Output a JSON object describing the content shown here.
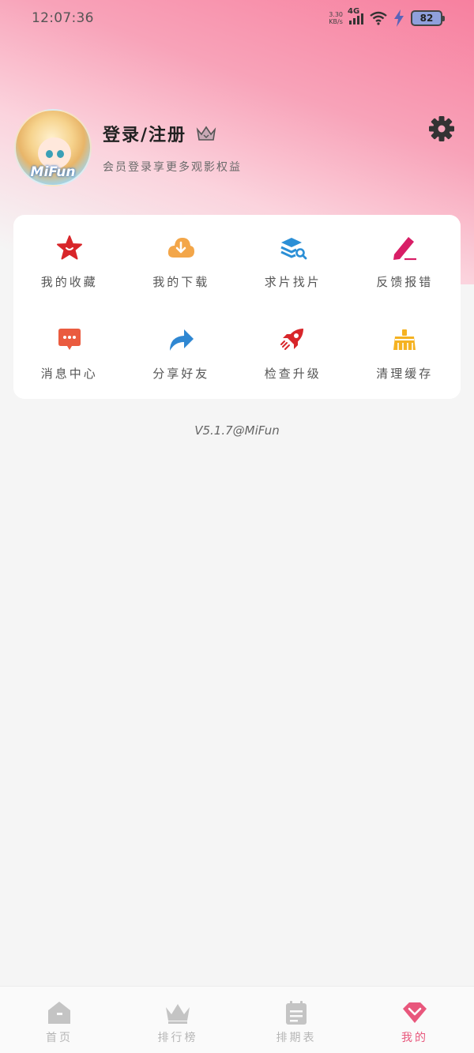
{
  "status_bar": {
    "time": "12:07:36",
    "net_speed_value": "3.30",
    "net_speed_unit": "KB/s",
    "network": "4G",
    "battery": "82"
  },
  "profile": {
    "avatar_text": "MiFun",
    "title": "登录/注册",
    "subtitle": "会员登录享更多观影权益"
  },
  "menu": {
    "items": [
      {
        "label": "我的收藏",
        "icon": "star-icon",
        "color": "#d8262a"
      },
      {
        "label": "我的下载",
        "icon": "cloud-download-icon",
        "color": "#f3a649"
      },
      {
        "label": "求片找片",
        "icon": "layers-search-icon",
        "color": "#2b8fd6"
      },
      {
        "label": "反馈报错",
        "icon": "pencil-icon",
        "color": "#d81e66"
      },
      {
        "label": "消息中心",
        "icon": "message-icon",
        "color": "#ea5b3f"
      },
      {
        "label": "分享好友",
        "icon": "share-arrow-icon",
        "color": "#2f87d2"
      },
      {
        "label": "检查升级",
        "icon": "rocket-icon",
        "color": "#d8262a"
      },
      {
        "label": "清理缓存",
        "icon": "broom-icon",
        "color": "#f5b221"
      }
    ]
  },
  "version": "V5.1.7@MiFun",
  "tabbar": {
    "tabs": [
      {
        "label": "首页",
        "icon": "home-icon"
      },
      {
        "label": "排行榜",
        "icon": "crown-icon"
      },
      {
        "label": "排期表",
        "icon": "calendar-icon"
      },
      {
        "label": "我的",
        "icon": "heart-diamond-icon",
        "active": true
      }
    ]
  },
  "colors": {
    "accent": "#e8577c",
    "inactive_tab": "#b5b5b5",
    "background": "#f5f5f5"
  }
}
